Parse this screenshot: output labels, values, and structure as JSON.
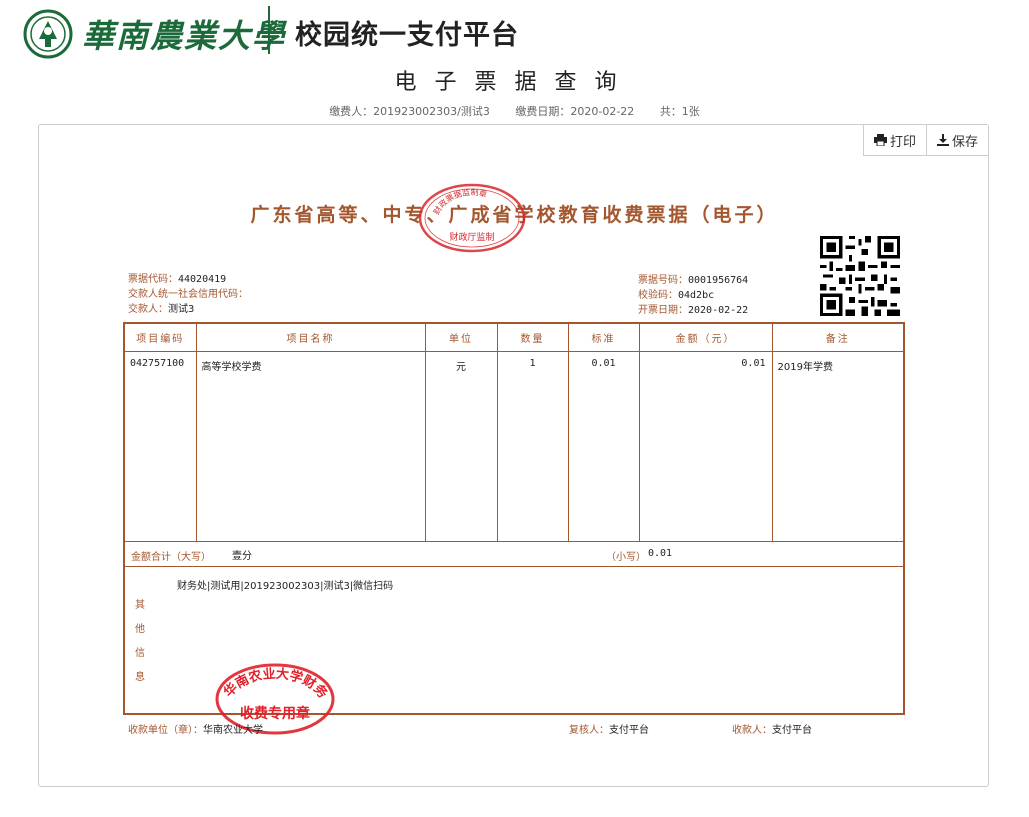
{
  "header": {
    "university_name": "華南農業大學",
    "platform_title": "校园统一支付平台",
    "brand_color": "#1b6b3a"
  },
  "page_title": "电子票据查询",
  "meta": {
    "payer": "缴费人：201923002303/测试3",
    "pay_date": "缴费日期：2020-02-22",
    "count": "共：1张"
  },
  "toolbar": {
    "print_label": "打印",
    "save_label": "保存"
  },
  "receipt": {
    "accent_color": "#a4572f",
    "title": "广东省高等、中专、广成省学校教育收费票据（电子）",
    "stamp_top": {
      "outer_text": "财政票据监制章",
      "inner_text": "广东省",
      "bottom_text": "财政厅监制"
    },
    "left_info": [
      {
        "label": "票据代码：",
        "value": "44020419"
      },
      {
        "label": "交款人统一社会信用代码：",
        "value": ""
      },
      {
        "label": "交款人：",
        "value": "测试3"
      }
    ],
    "right_info": [
      {
        "label": "票据号码：",
        "value": "0001956764"
      },
      {
        "label": "校验码：",
        "value": "04d2bc"
      },
      {
        "label": "开票日期：",
        "value": "2020-02-22"
      }
    ],
    "columns": [
      "项目编码",
      "项目名称",
      "单位",
      "数量",
      "标准",
      "金额（元）",
      "备注"
    ],
    "rows": [
      {
        "code": "042757100",
        "name": "高等学校学费",
        "unit": "元",
        "qty": "1",
        "std": "0.01",
        "amount": "0.01",
        "note": "2019年学费"
      }
    ],
    "total_label": "金额合计（大写）",
    "total_value": "壹分",
    "small_label": "（小写）",
    "small_value": "0.01",
    "other_label": "其他信息",
    "other_value": "财务处|测试用|201923002303|测试3|微信扫码",
    "stamp_bottom": {
      "outer_text": "华南农业大学财务处",
      "inner_text": "收费专用章"
    },
    "footer": {
      "payee_unit_label": "收款单位（章）：",
      "payee_unit_value": "华南农业大学",
      "reviewer_label": "复核人：",
      "reviewer_value": "支付平台",
      "collector_label": "收款人：",
      "collector_value": "支付平台"
    }
  }
}
